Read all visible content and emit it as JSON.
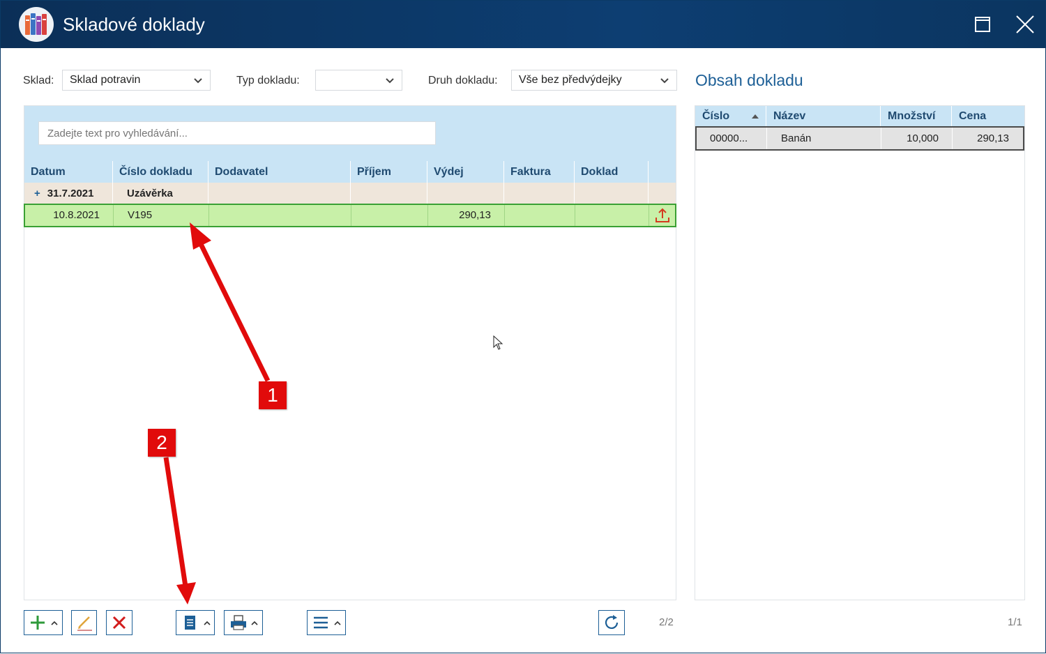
{
  "window": {
    "title": "Skladové doklady"
  },
  "filters": {
    "sklad_label": "Sklad:",
    "sklad_value": "Sklad potravin",
    "typ_label": "Typ dokladu:",
    "typ_value": "",
    "druh_label": "Druh dokladu:",
    "druh_value": "Vše bez předvýdejky"
  },
  "search": {
    "placeholder": "Zadejte text pro vyhledávání..."
  },
  "left_table": {
    "columns": [
      "Datum",
      "Číslo dokladu",
      "Dodavatel",
      "Příjem",
      "Výdej",
      "Faktura",
      "Doklad"
    ],
    "group_row": {
      "expand": "+",
      "datum": "31.7.2021",
      "cislo": "Uzávěrka"
    },
    "rows": [
      {
        "datum": "10.8.2021",
        "cislo": "V195",
        "dodavatel": "",
        "prijem": "",
        "vydej": "290,13",
        "faktura": "",
        "doklad": ""
      }
    ]
  },
  "right_pane": {
    "title": "Obsah dokladu",
    "columns": [
      "Číslo",
      "Název",
      "Množství",
      "Cena"
    ],
    "rows": [
      {
        "cislo": "00000...",
        "nazev": "Banán",
        "mnozstvi": "10,000",
        "cena": "290,13"
      }
    ],
    "counter": "1/1"
  },
  "footer": {
    "left_counter": "2/2"
  },
  "annotations": {
    "callout_1": "1",
    "callout_2": "2"
  },
  "colors": {
    "titlebar": "#0d3e72",
    "accent": "#1d5f96",
    "selected_row": "#c8f0a8",
    "callout": "#e10b0b"
  }
}
